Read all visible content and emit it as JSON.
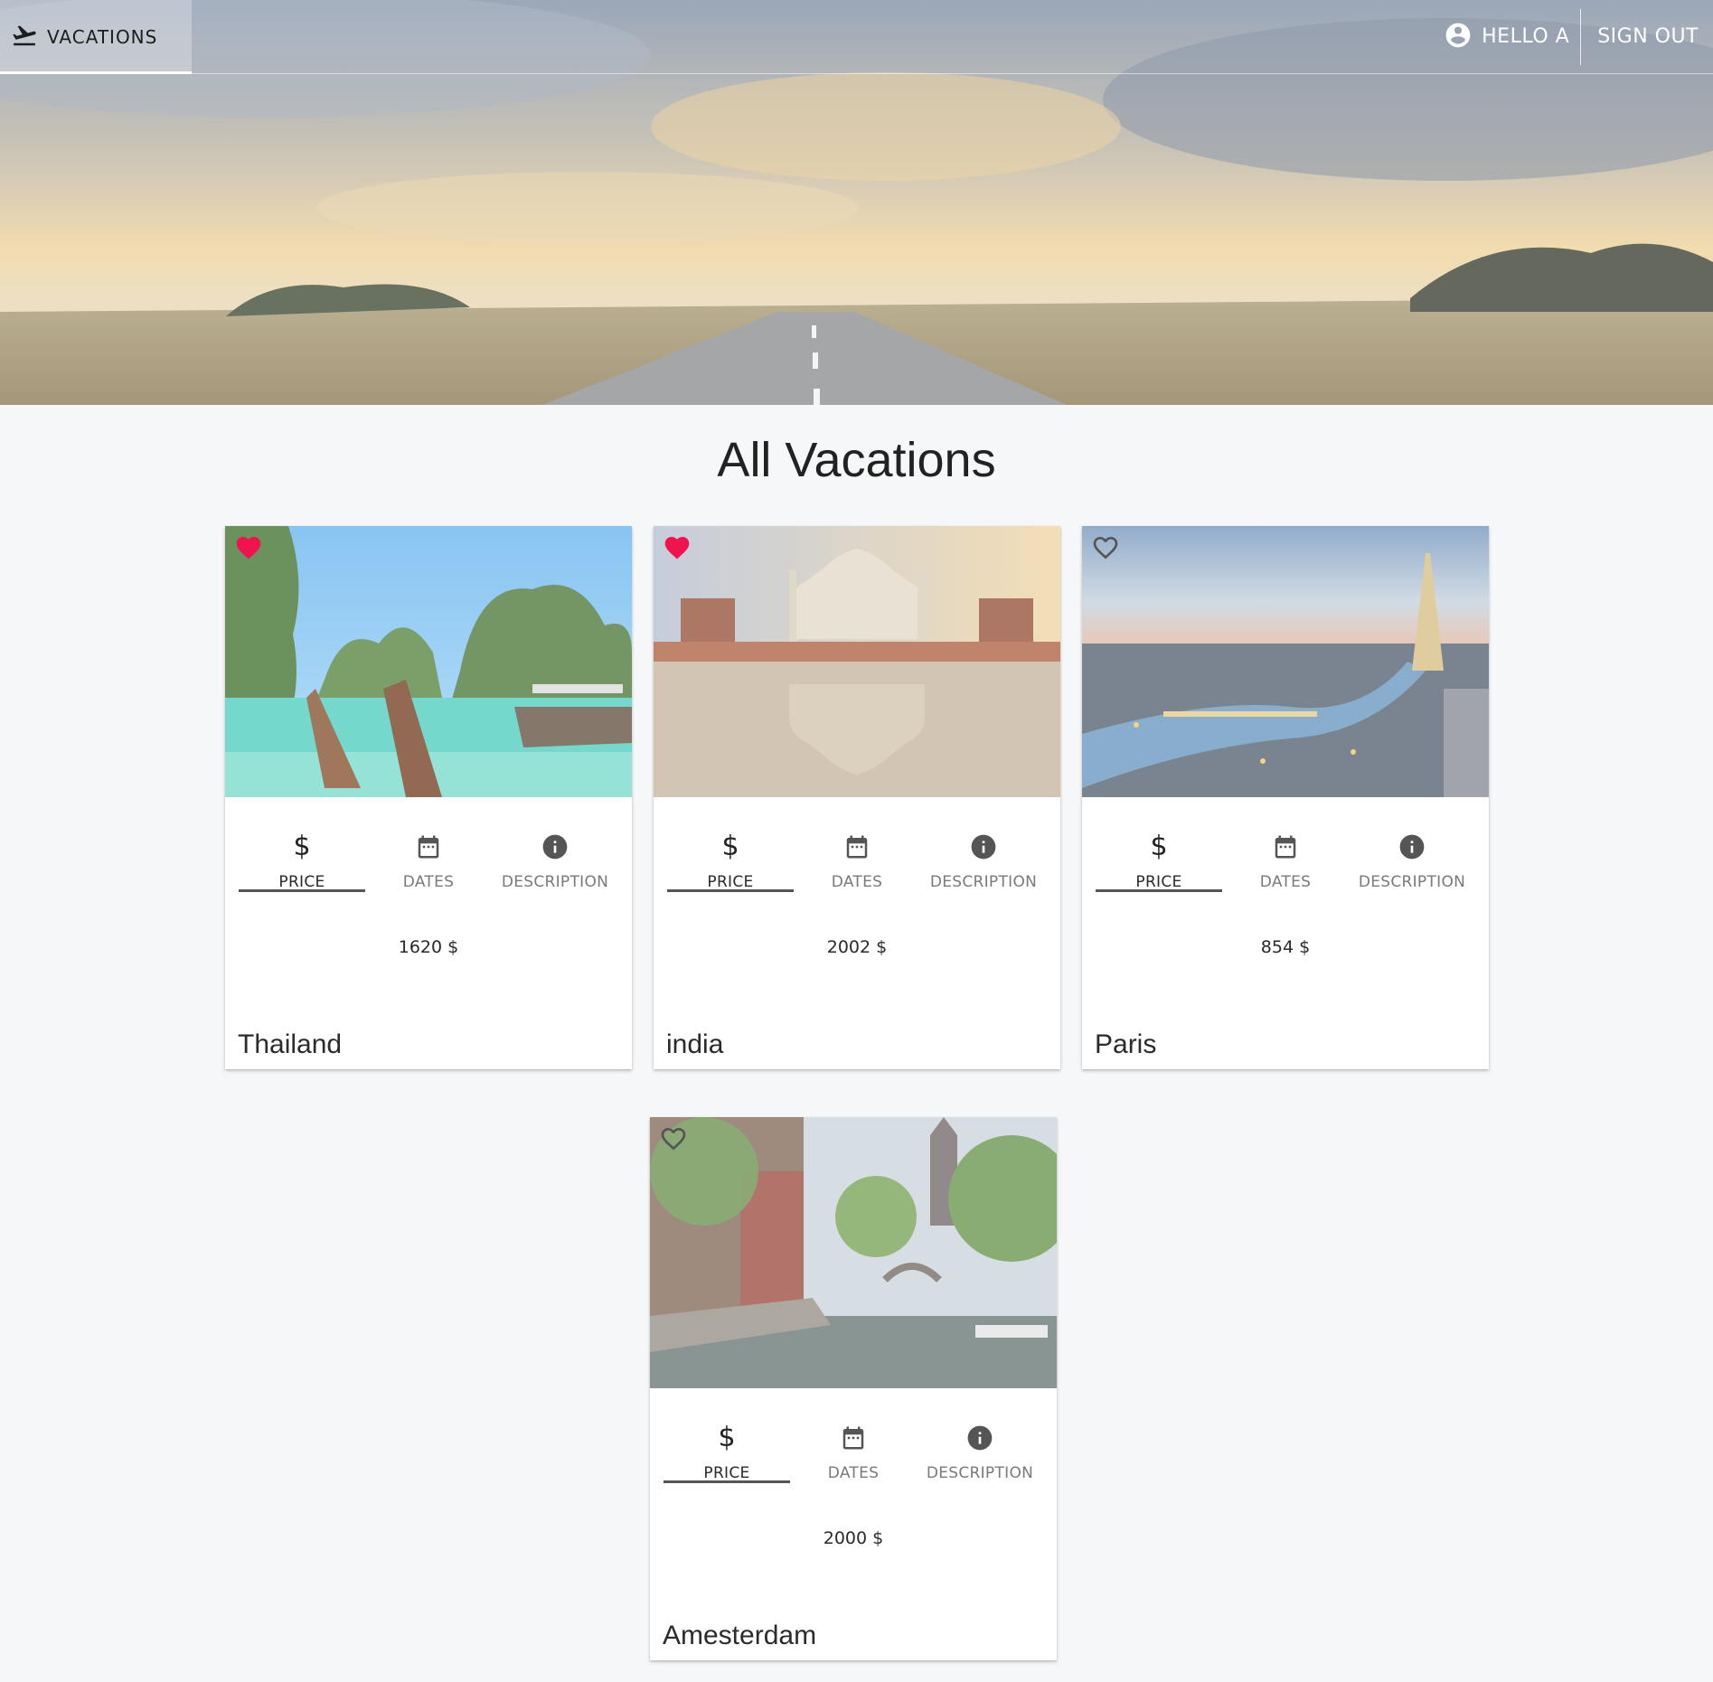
{
  "nav": {
    "vacations_label": "VACATIONS",
    "greeting": "HELLO A",
    "signout_label": "SIGN OUT"
  },
  "page": {
    "title": "All Vacations"
  },
  "tabs": {
    "price": "PRICE",
    "dates": "DATES",
    "description": "DESCRIPTION"
  },
  "colors": {
    "favorite": "#f0134d",
    "accent": "#555555"
  },
  "vacations": [
    {
      "name": "Thailand",
      "price": "1620 $",
      "favorite": true
    },
    {
      "name": "india",
      "price": "2002 $",
      "favorite": true
    },
    {
      "name": "Paris",
      "price": "854 $",
      "favorite": false
    },
    {
      "name": "Amesterdam",
      "price": "2000 $",
      "favorite": false
    }
  ]
}
